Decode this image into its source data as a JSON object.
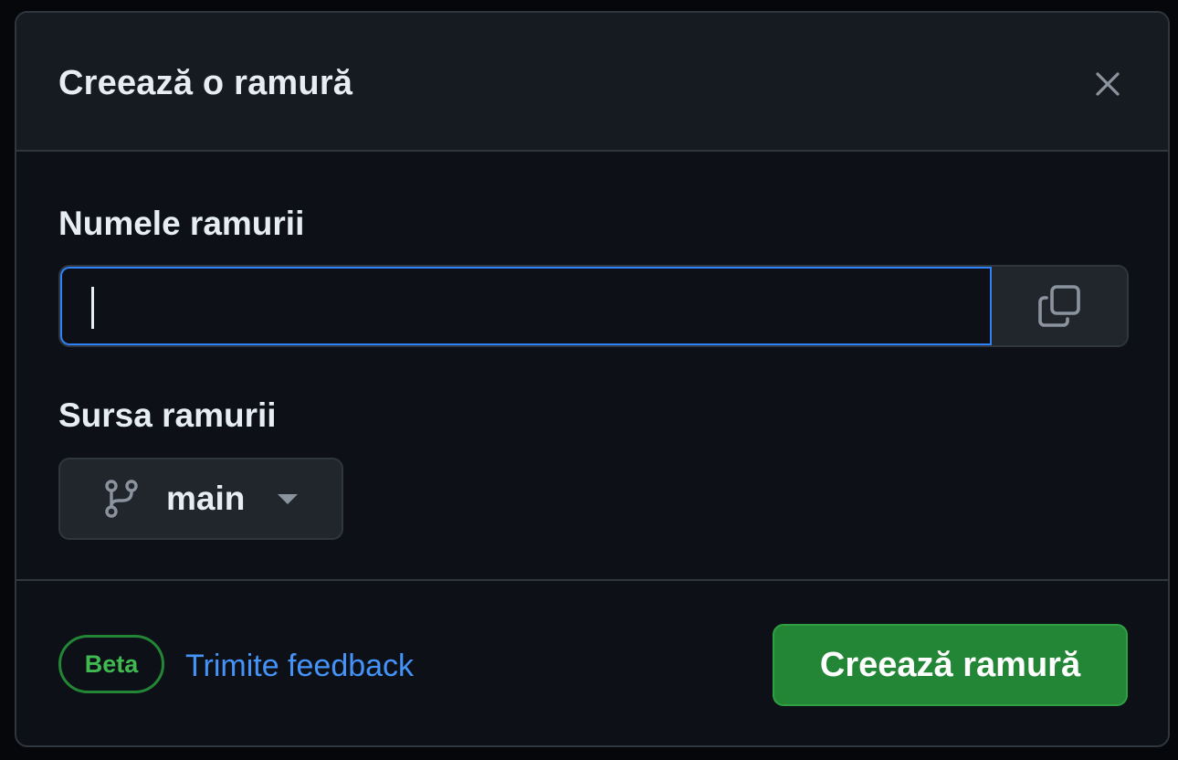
{
  "dialog": {
    "title": "Creează o ramură",
    "close_icon": "close-icon"
  },
  "form": {
    "name_label": "Numele ramurii",
    "name_value": "",
    "name_placeholder": "",
    "copy_icon": "copy-icon",
    "source_label": "Sursa ramurii",
    "source_branch": "main",
    "branch_icon": "git-branch-icon",
    "dropdown_icon": "chevron-down-icon"
  },
  "footer": {
    "beta_badge": "Beta",
    "feedback_link": "Trimite feedback",
    "create_button": "Creează ramură"
  },
  "colors": {
    "background": "#0d1117",
    "header_background": "#161b22",
    "border": "#30363d",
    "focus_ring": "#2f81f7",
    "primary_button": "#238636",
    "beta_green": "#3fb950",
    "link_blue": "#4493f8",
    "text": "#e6edf3"
  }
}
